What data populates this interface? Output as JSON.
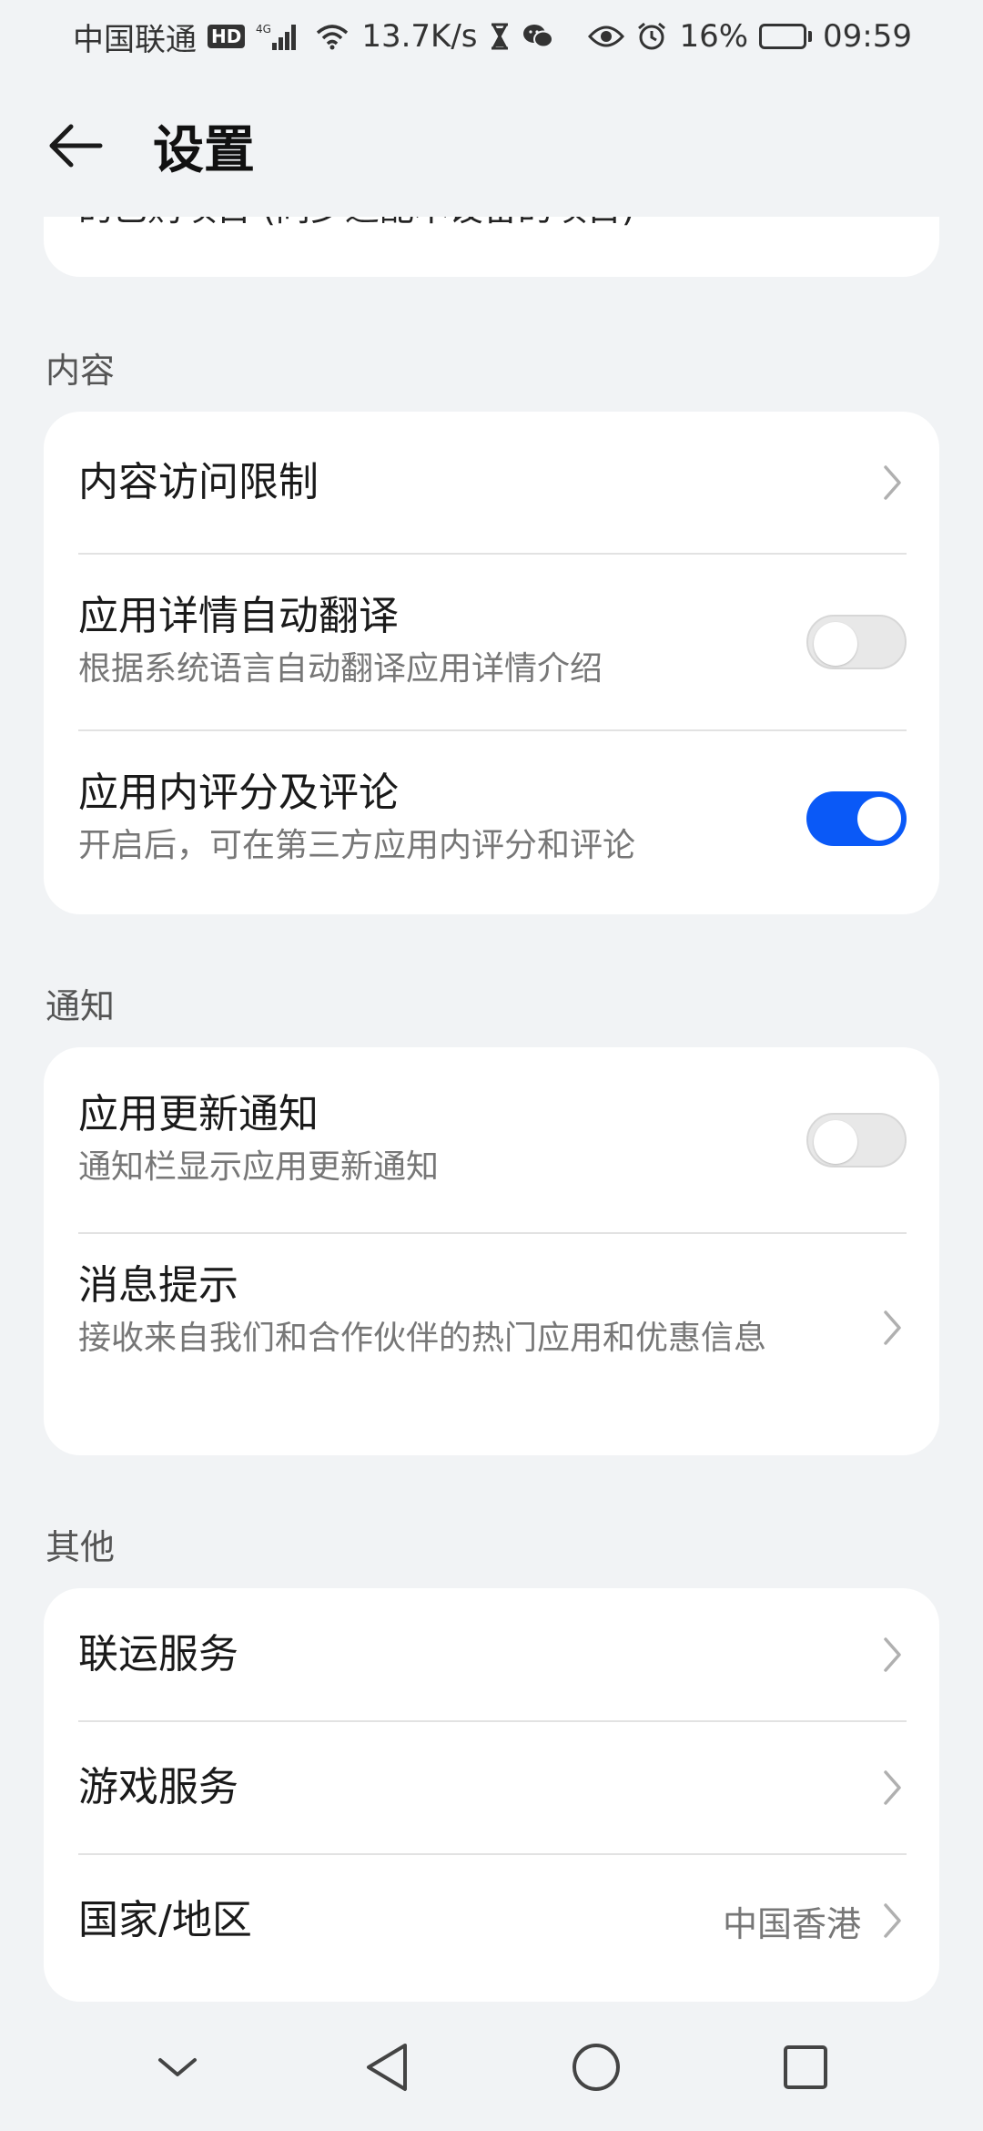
{
  "status_bar": {
    "carrier": "中国联通",
    "hd": "HD",
    "network": "4G",
    "speed": "13.7K/s",
    "battery": "16%",
    "battery_level": 0.16,
    "time": "09:59",
    "icons": [
      "signal-icon",
      "wifi-icon",
      "hourglass-icon",
      "wechat-icon",
      "eye-icon",
      "alarm-icon",
      "battery-icon"
    ]
  },
  "header": {
    "back_icon": "back-arrow-icon",
    "title": "设置"
  },
  "partial_card": {
    "text": "的已购项目 (同步适配本设备的项目)"
  },
  "sections": {
    "content": {
      "label": "内容",
      "items": [
        {
          "title": "内容访问限制",
          "type": "link"
        },
        {
          "title": "应用详情自动翻译",
          "subtitle": "根据系统语言自动翻译应用详情介绍",
          "type": "toggle",
          "on": false
        },
        {
          "title": "应用内评分及评论",
          "subtitle": "开启后，可在第三方应用内评分和评论",
          "type": "toggle",
          "on": true
        }
      ]
    },
    "notification": {
      "label": "通知",
      "items": [
        {
          "title": "应用更新通知",
          "subtitle": "通知栏显示应用更新通知",
          "type": "toggle",
          "on": false
        },
        {
          "title": "消息提示",
          "subtitle": "接收来自我们和合作伙伴的热门应用和优惠信息",
          "type": "link"
        }
      ]
    },
    "other": {
      "label": "其他",
      "items": [
        {
          "title": "联运服务",
          "type": "link"
        },
        {
          "title": "游戏服务",
          "type": "link"
        },
        {
          "title": "国家/地区",
          "value": "中国香港",
          "type": "link"
        }
      ]
    }
  },
  "colors": {
    "accent": "#0a59f7",
    "background": "#f1f3f5",
    "card": "#ffffff"
  },
  "nav_bar": {
    "icons": [
      "collapse-icon",
      "back-triangle-icon",
      "home-circle-icon",
      "recents-square-icon"
    ]
  }
}
